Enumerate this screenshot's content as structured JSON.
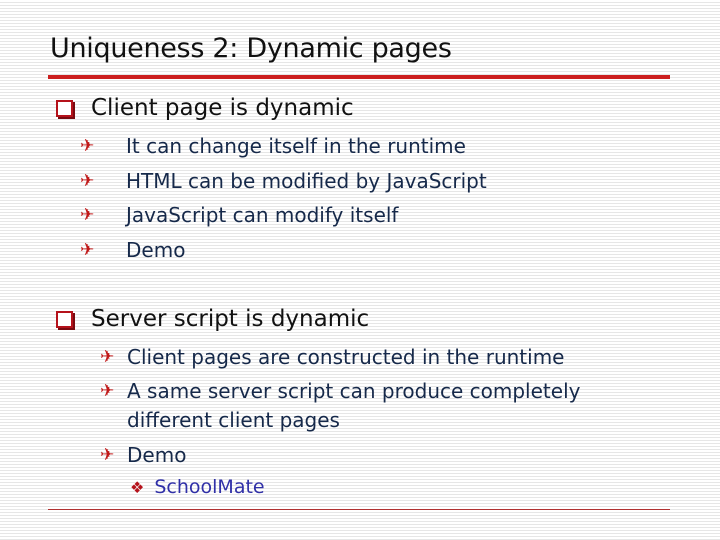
{
  "title": "Uniqueness 2: Dynamic pages",
  "sections": [
    {
      "heading": "Client page is dynamic",
      "items": [
        "It can change itself in the runtime",
        "HTML can be modified by JavaScript",
        "JavaScript can modify itself",
        "Demo"
      ]
    },
    {
      "heading": "Server script is dynamic",
      "items": [
        "Client pages are constructed in the runtime",
        "A same server script can produce completely",
        "different client pages",
        "Demo"
      ],
      "subitems": [
        "SchoolMate"
      ]
    }
  ],
  "icons": {
    "level1": "square-bullet-icon",
    "level2": "airplane-bullet-icon",
    "level3": "diamond-bullet-icon"
  },
  "colors": {
    "accent": "#cc1f1f",
    "text_level2": "#16294a",
    "text_level3": "#3030a8"
  }
}
